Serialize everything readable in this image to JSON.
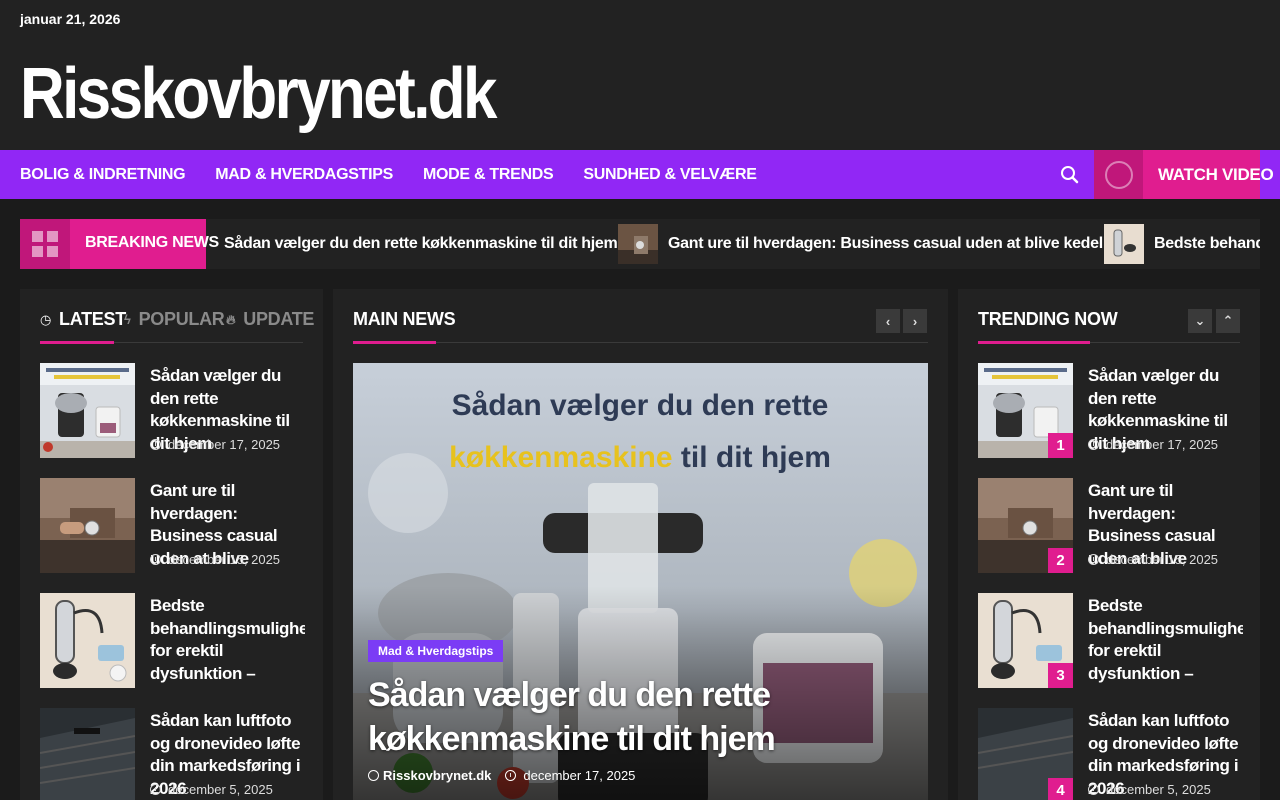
{
  "site": {
    "date": "januar 21, 2026",
    "name": "Risskovbrynet.dk"
  },
  "nav": {
    "items": [
      "BOLIG & INDRETNING",
      "MAD & HVERDAGSTIPS",
      "MODE & TRENDS",
      "SUNDHED & VELVÆRE"
    ],
    "watch_label": "WATCH VIDEO",
    "search_icon": "search-icon"
  },
  "breaking": {
    "label": "BREAKING NEWS",
    "items": [
      "Sådan vælger du den rette køkkenmaskine til dit hjem",
      "Gant ure til hverdagen: Business casual uden at blive kedelig",
      "Bedste behand"
    ]
  },
  "left_panel": {
    "tabs": [
      "LATEST",
      "POPULAR",
      "UPDATE"
    ],
    "items": [
      {
        "title": "Sådan vælger du den rette køkkenmaskine til dit hjem",
        "date": "december 17, 2025"
      },
      {
        "title": "Gant ure til hverdagen: Business casual uden at blive kedelig",
        "date": "december 15, 2025"
      },
      {
        "title": "Bedste behandlingsmuligheder for erektil dysfunktion – ",
        "date": ""
      },
      {
        "title": "Sådan kan luftfoto og dronevideo løfte din markedsføring i 2026",
        "date": "december 5, 2025"
      }
    ]
  },
  "main_news": {
    "title": "MAIN NEWS",
    "hero": {
      "image_line1": "Sådan vælger du den rette",
      "image_line2a": "køkkenmaskine",
      "image_line2b": " til dit hjem",
      "category": "Mad & Hverdagstips",
      "title": "Sådan vælger du den rette køkkenmaskine til dit hjem",
      "author": "Risskovbrynet.dk",
      "date": "december 17, 2025"
    }
  },
  "trending": {
    "title": "TRENDING NOW",
    "items": [
      {
        "rank": "1",
        "title": "Sådan vælger du den rette køkkenmaskine til dit hjem",
        "date": "december 17, 2025"
      },
      {
        "rank": "2",
        "title": "Gant ure til hverdagen: Business casual uden at blive kedelig",
        "date": "december 15, 2025"
      },
      {
        "rank": "3",
        "title": "Bedste behandlingsmuligheder for erektil dysfunktion – ",
        "date": ""
      },
      {
        "rank": "4",
        "title": "Sådan kan luftfoto og dronevideo løfte din markedsføring i 2026",
        "date": "december 5, 2025"
      }
    ]
  },
  "colors": {
    "nav_bg": "#9127f5",
    "accent": "#e01d8f",
    "category_badge": "#7b3cf5",
    "panel_bg": "#222222"
  }
}
